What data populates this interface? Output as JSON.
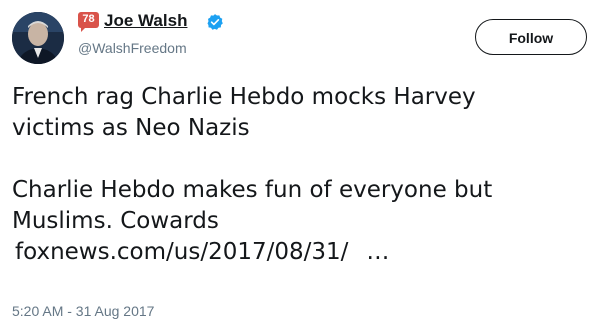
{
  "author": {
    "name": "Joe Walsh",
    "handle": "@WalshFreedom",
    "badge": "78",
    "verified_icon": "verified-badge-icon",
    "badge_color": "#d9534a",
    "verified_color": "#1da1f2"
  },
  "follow_button": {
    "label": "Follow"
  },
  "tweet": {
    "lines": [
      "French rag Charlie Hebdo mocks Harvey",
      "victims as Neo Nazis",
      "Charlie Hebdo makes fun of everyone but",
      "Muslims. Cowards"
    ],
    "link": "foxnews.com/us/2017/08/31/",
    "ellipsis": "…"
  },
  "timestamp": "5:20 AM - 31 Aug 2017"
}
